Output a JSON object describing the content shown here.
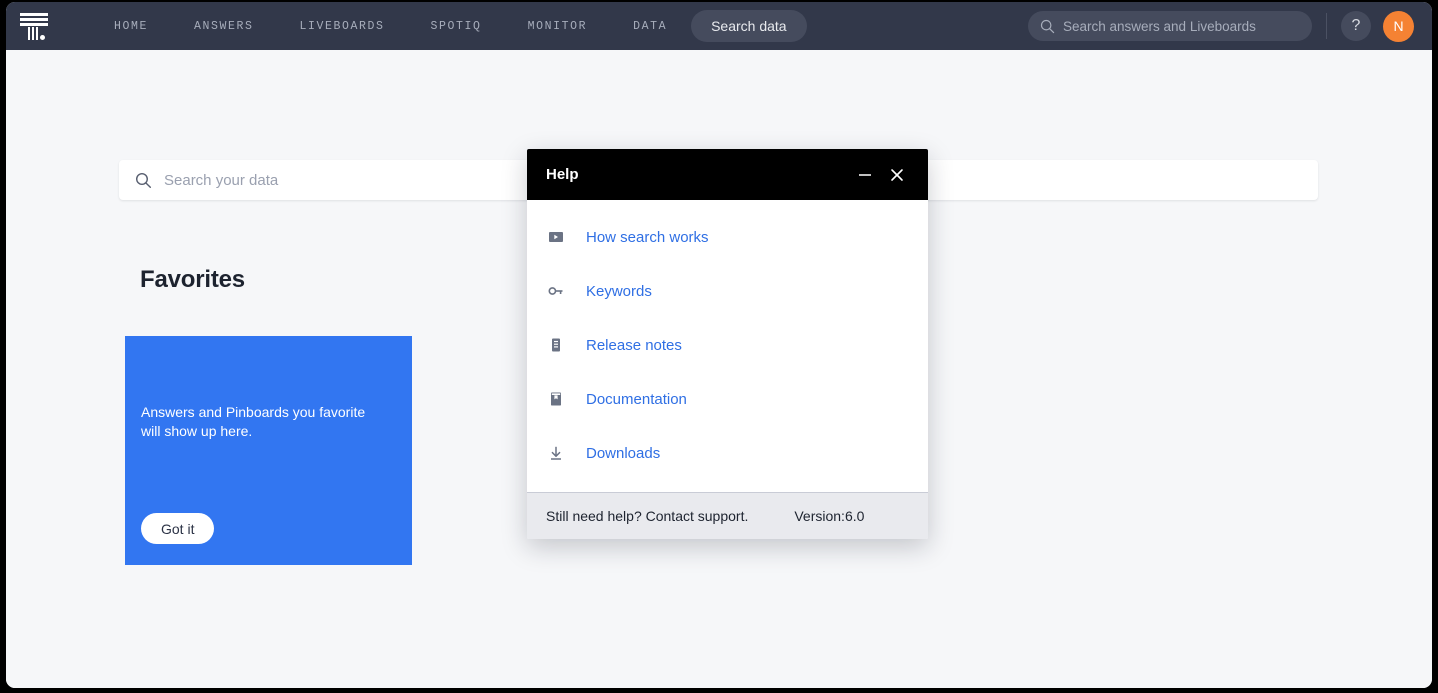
{
  "nav": {
    "logo_name": "thoughtspot-logo",
    "links": [
      {
        "label": "HOME"
      },
      {
        "label": "ANSWERS"
      },
      {
        "label": "LIVEBOARDS"
      },
      {
        "label": "SPOTIQ"
      },
      {
        "label": "MONITOR"
      },
      {
        "label": "DATA"
      }
    ],
    "search_data_label": "Search data",
    "global_search_placeholder": "Search answers and Liveboards",
    "help_button_label": "?",
    "avatar_initial": "N"
  },
  "main": {
    "search_placeholder": "Search your data",
    "favorites_title": "Favorites",
    "favorites_card": {
      "message": "Answers and Pinboards you favorite will show up here.",
      "button_label": "Got it"
    }
  },
  "help_dialog": {
    "title": "Help",
    "minimize_label": "–",
    "close_label": "✕",
    "items": [
      {
        "label": "How search works",
        "icon": "video-icon"
      },
      {
        "label": "Keywords",
        "icon": "key-icon"
      },
      {
        "label": "Release notes",
        "icon": "notes-icon"
      },
      {
        "label": "Documentation",
        "icon": "book-icon"
      },
      {
        "label": "Downloads",
        "icon": "download-icon"
      }
    ],
    "footer_support": "Still need help? Contact support.",
    "footer_version": "Version:6.0"
  },
  "colors": {
    "nav_bg": "#32384a",
    "page_bg": "#f6f7f9",
    "accent_blue": "#3276f1",
    "link_blue": "#2f6fe4",
    "avatar_orange": "#f58233",
    "dialog_header": "#000000",
    "dialog_footer": "#e9eaee"
  }
}
